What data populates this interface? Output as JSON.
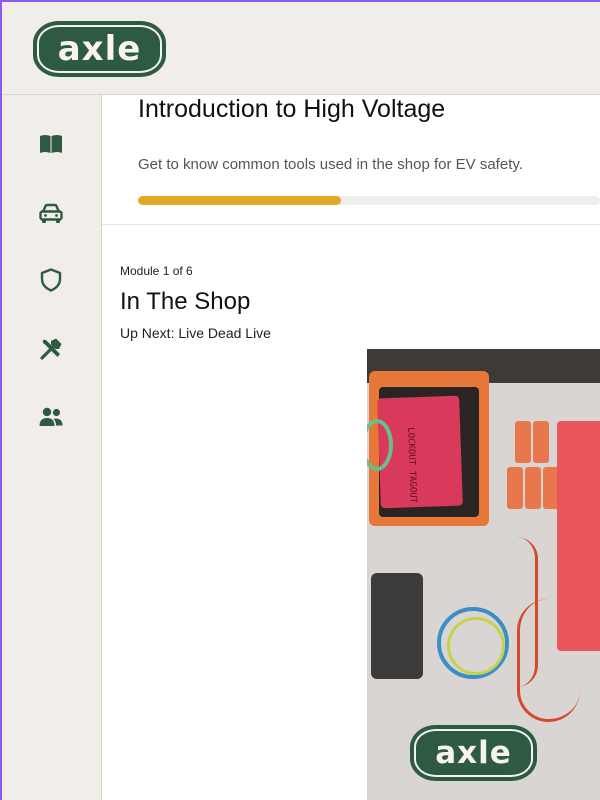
{
  "brand": {
    "logo_text": "axle",
    "color": "#2e5a43"
  },
  "sidebar": {
    "items": [
      {
        "icon": "book-icon"
      },
      {
        "icon": "car-icon"
      },
      {
        "icon": "shield-icon"
      },
      {
        "icon": "tools-icon"
      },
      {
        "icon": "people-icon"
      }
    ]
  },
  "course": {
    "title": "Introduction to High Voltage",
    "description": "Get to know common tools used in the shop for EV safety.",
    "progress_fraction": 0.44,
    "progress_color": "#e3a824"
  },
  "module": {
    "count_label": "Module 1 of 6",
    "title": "In The Shop",
    "up_next": "Up Next: Live Dead Live"
  },
  "media": {
    "watermark_text": "axle",
    "bag_text": "LOCKOUT TAGOUT"
  }
}
